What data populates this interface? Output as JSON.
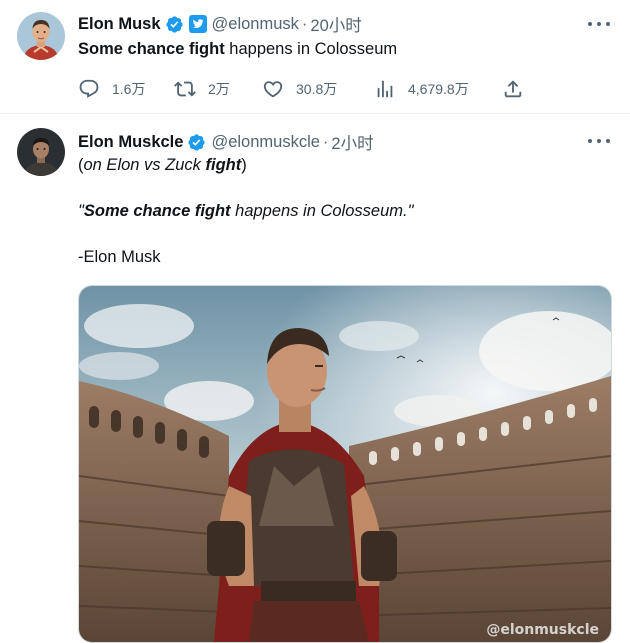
{
  "tweet1": {
    "name": "Elon Musk",
    "handle": "@elonmusk",
    "separator": "·",
    "time": "20小时",
    "text_bold": "Some chance fight",
    "text_rest": " happens in Colosseum",
    "actions": {
      "reply_count": "1.6万",
      "retweet_count": "2万",
      "like_count": "30.8万",
      "view_count": "4,679.8万"
    }
  },
  "tweet2": {
    "name": "Elon Muskcle",
    "handle": "@elonmuskcle",
    "separator": "·",
    "time": "2小时",
    "line1_open": "(",
    "line1_text": "on Elon vs Zuck ",
    "line1_bold": "fight",
    "line1_close": ")",
    "quote_open": "\"",
    "quote_bold": "Some chance fight",
    "quote_rest": " happens in Colosseum.",
    "quote_close": "\"",
    "signature": "-Elon Musk",
    "image_watermark": "@elonmuskcle"
  },
  "icons": {
    "verified": "verified-badge-icon",
    "twitter_blue": "twitter-blue-icon",
    "more": "more-icon",
    "reply": "reply-icon",
    "retweet": "retweet-icon",
    "like": "like-icon",
    "views": "views-icon",
    "share": "share-icon"
  },
  "colors": {
    "accent": "#1d9bf0",
    "text": "#0f1419",
    "muted": "#536471"
  }
}
